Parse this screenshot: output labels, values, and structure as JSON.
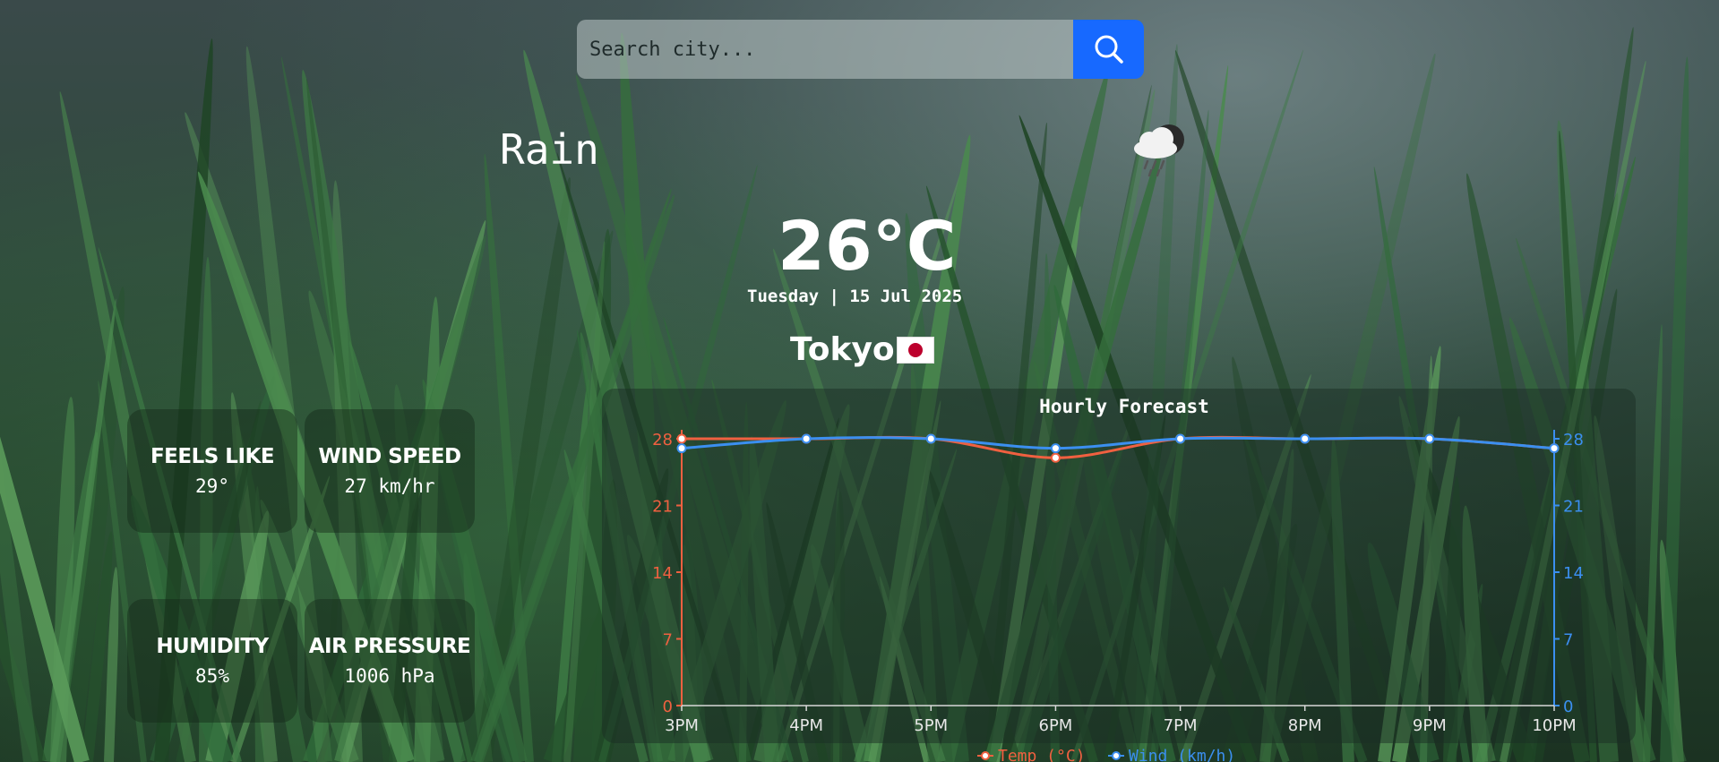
{
  "search": {
    "placeholder": "Search city...",
    "value": "",
    "button_icon": "search-icon",
    "button_color": "#1769ff"
  },
  "weather": {
    "condition": "Rain",
    "icon": "cloud-rain-icon",
    "temperature": "26°C",
    "date": "Tuesday | 15 Jul 2025",
    "city": "Tokyo",
    "flag": "japan-flag-icon"
  },
  "stats": [
    {
      "title": "FEELS LIKE",
      "value": "29°"
    },
    {
      "title": "WIND SPEED",
      "value": "27 km/hr"
    },
    {
      "title": "HUMIDITY",
      "value": "85%"
    },
    {
      "title": "AIR PRESSURE",
      "value": "1006 hPa"
    }
  ],
  "chart_data": {
    "type": "line",
    "title": "Hourly Forecast",
    "categories": [
      "3PM",
      "4PM",
      "5PM",
      "6PM",
      "7PM",
      "8PM",
      "9PM",
      "10PM"
    ],
    "series": [
      {
        "name": "Temp (°C)",
        "values": [
          28,
          28,
          28,
          26,
          28,
          28,
          28,
          27
        ],
        "color": "#f06040",
        "axis": "left"
      },
      {
        "name": "Wind (km/h)",
        "values": [
          27,
          28,
          28,
          27,
          28,
          28,
          28,
          27
        ],
        "color": "#3b8ff0",
        "axis": "right"
      }
    ],
    "y_left": {
      "ticks": [
        0,
        7,
        14,
        21,
        28
      ],
      "ylim": [
        0,
        28
      ]
    },
    "y_right": {
      "ticks": [
        0,
        7,
        14,
        21,
        28
      ],
      "ylim": [
        0,
        28
      ]
    },
    "legend_position": "bottom-center",
    "grid": false
  }
}
